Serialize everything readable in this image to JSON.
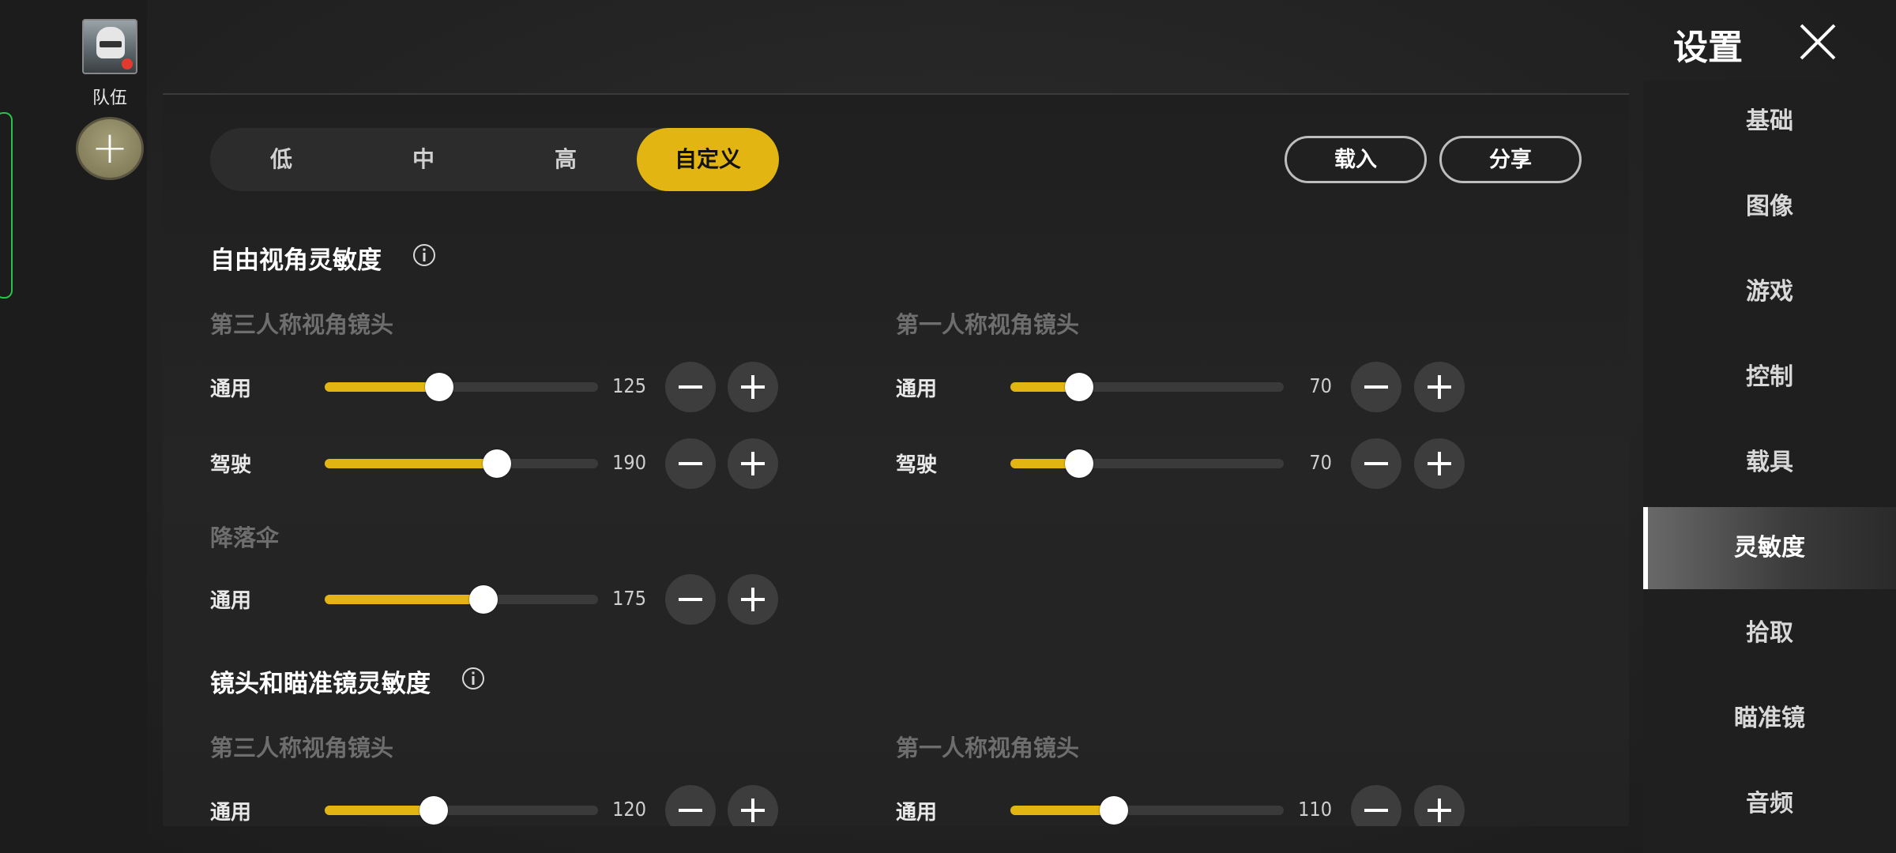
{
  "team": {
    "label": "队伍",
    "add_icon": "plus-icon"
  },
  "header": {
    "title": "设置",
    "close_icon": "close-icon"
  },
  "presets": {
    "options": [
      "低",
      "中",
      "高",
      "自定义"
    ],
    "selected": "自定义",
    "load_label": "载入",
    "share_label": "分享"
  },
  "colors": {
    "accent": "#e3b512",
    "track": "#3a3a3a"
  },
  "free_look": {
    "title": "自由视角灵敏度",
    "third_person": {
      "title": "第三人称视角镜头",
      "rows": [
        {
          "label": "通用",
          "value": "125"
        },
        {
          "label": "驾驶",
          "value": "190"
        }
      ]
    },
    "first_person": {
      "title": "第一人称视角镜头",
      "rows": [
        {
          "label": "通用",
          "value": "70"
        },
        {
          "label": "驾驶",
          "value": "70"
        }
      ]
    },
    "parachute": {
      "title": "降落伞",
      "rows": [
        {
          "label": "通用",
          "value": "175"
        }
      ]
    }
  },
  "camera_scope": {
    "title": "镜头和瞄准镜灵敏度",
    "third_person": {
      "title": "第三人称视角镜头",
      "rows": [
        {
          "label": "通用",
          "value": "120"
        }
      ]
    },
    "first_person": {
      "title": "第一人称视角镜头",
      "rows": [
        {
          "label": "通用",
          "value": "110"
        }
      ]
    }
  },
  "nav": {
    "items": [
      "基础",
      "图像",
      "游戏",
      "控制",
      "载具",
      "灵敏度",
      "拾取",
      "瞄准镜",
      "音频"
    ],
    "active": "灵敏度"
  }
}
